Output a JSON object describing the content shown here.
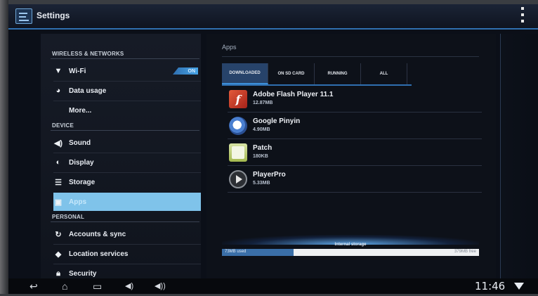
{
  "actionbar": {
    "title": "Settings",
    "app_icon": "settings-app-icon",
    "overflow_icon": "overflow-menu-icon"
  },
  "sidebar": {
    "sections": [
      "WIRELESS & NETWORKS",
      "DEVICE",
      "PERSONAL"
    ],
    "wifi_toggle": "ON",
    "items": [
      {
        "label": "Wi-Fi",
        "icon": "wifi-icon"
      },
      {
        "label": "Data usage",
        "icon": "data-usage-icon"
      },
      {
        "label": "More...",
        "icon": ""
      },
      {
        "label": "Sound",
        "icon": "speaker-icon"
      },
      {
        "label": "Display",
        "icon": "display-icon"
      },
      {
        "label": "Storage",
        "icon": "storage-icon"
      },
      {
        "label": "Apps",
        "icon": "apps-icon"
      },
      {
        "label": "Accounts & sync",
        "icon": "sync-icon"
      },
      {
        "label": "Location services",
        "icon": "location-icon"
      },
      {
        "label": "Security",
        "icon": "lock-icon"
      }
    ]
  },
  "main": {
    "title": "Apps",
    "tabs": [
      "DOWNLOADED",
      "ON SD CARD",
      "RUNNING",
      "ALL"
    ],
    "apps": [
      {
        "name": "Adobe Flash Player 11.1",
        "size": "12.87MB"
      },
      {
        "name": "Google Pinyin",
        "size": "4.90MB"
      },
      {
        "name": "Patch",
        "size": "180KB"
      },
      {
        "name": "PlayerPro",
        "size": "5.33MB"
      }
    ],
    "storage": {
      "label": "Internal storage",
      "used": "73MB used",
      "free": "379MB free",
      "used_fraction": 0.28
    }
  },
  "system_bar": {
    "time": "11:46"
  },
  "colors": {
    "accent": "#2f6fb0",
    "selected": "#7fc3ea"
  }
}
